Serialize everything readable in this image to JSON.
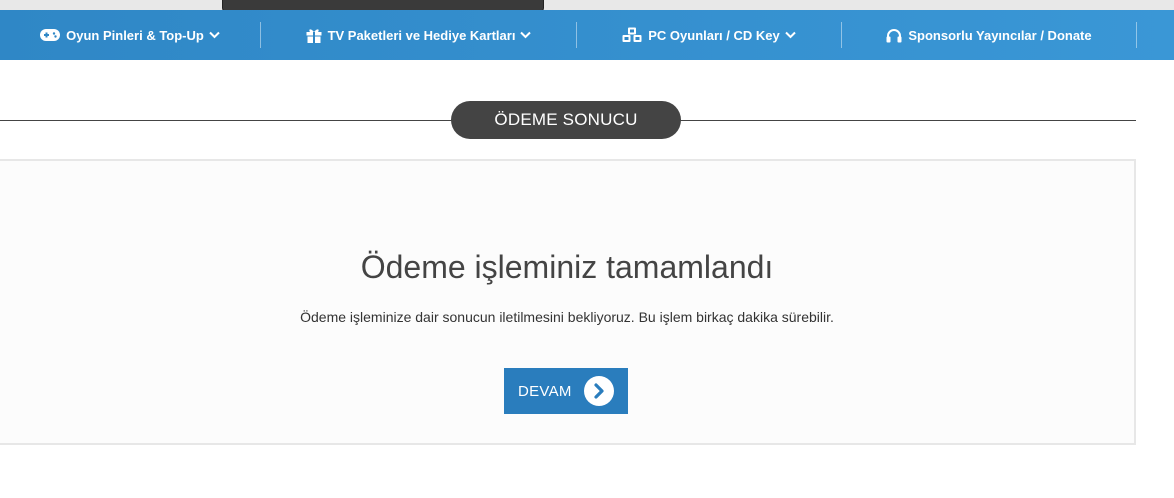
{
  "colors": {
    "nav_start": "#2f87c6",
    "nav_end": "#3a97d6",
    "pill_bg": "#444444",
    "button_bg": "#2a7dbd",
    "card_bg": "#fcfcfc",
    "card_border": "#e7e7e7"
  },
  "nav": {
    "items": [
      {
        "label": "Oyun Pinleri & Top-Up",
        "icon": "gamepad-icon",
        "dropdown": true
      },
      {
        "label": "TV Paketleri ve Hediye Kartları",
        "icon": "gift-icon",
        "dropdown": true
      },
      {
        "label": "PC Oyunları / CD Key",
        "icon": "cubes-icon",
        "dropdown": true
      },
      {
        "label": "Sponsorlu Yayıncılar / Donate",
        "icon": "headphones-icon",
        "dropdown": false
      }
    ]
  },
  "section": {
    "title": "ÖDEME SONUCU"
  },
  "result": {
    "title": "Ödeme işleminiz tamamlandı",
    "message": "Ödeme işleminize dair sonucun iletilmesini bekliyoruz. Bu işlem birkaç dakika sürebilir.",
    "button_label": "DEVAM",
    "button_icon": "chevron-right-circle-icon"
  }
}
